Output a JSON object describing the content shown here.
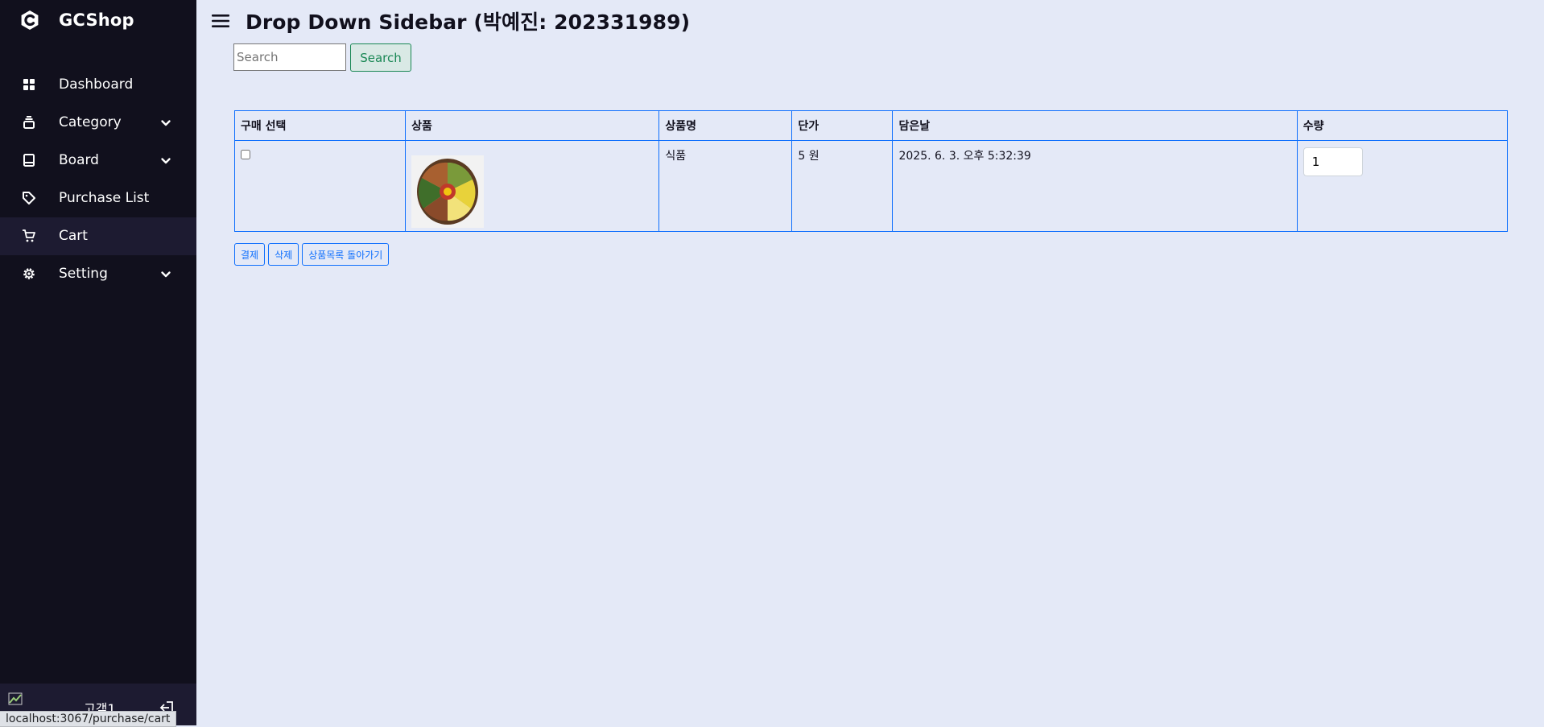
{
  "app": {
    "name": "GCShop",
    "page_title": "Drop Down Sidebar (박예진: 202331989)"
  },
  "sidebar": {
    "items": [
      {
        "label": "Dashboard",
        "icon": "grid-icon",
        "has_submenu": false
      },
      {
        "label": "Category",
        "icon": "layers-icon",
        "has_submenu": true
      },
      {
        "label": "Board",
        "icon": "book-icon",
        "has_submenu": true
      },
      {
        "label": "Purchase List",
        "icon": "tag-icon",
        "has_submenu": false
      },
      {
        "label": "Cart",
        "icon": "cart-icon",
        "has_submenu": false,
        "active": true
      },
      {
        "label": "Setting",
        "icon": "cog-icon",
        "has_submenu": true
      }
    ],
    "profile": {
      "name": "고객1"
    }
  },
  "status_url": "localhost:3067/purchase/cart",
  "search": {
    "placeholder": "Search",
    "value": "",
    "button_label": "Search"
  },
  "table": {
    "headers": [
      "구매 선택",
      "상품",
      "상품명",
      "단가",
      "담은날",
      "수량"
    ],
    "rows": [
      {
        "checked": false,
        "product_name": "식품",
        "price": "5 원",
        "date": "2025. 6. 3. 오후 5:32:39",
        "qty": "1"
      }
    ]
  },
  "actions": {
    "pay": "결제",
    "delete": "삭제",
    "back": "상품목록 돌아가기"
  },
  "colors": {
    "sidebar_bg": "#11101d",
    "page_bg": "#e4e9f7",
    "accent_blue": "#0d6efd",
    "accent_green": "#198754"
  }
}
